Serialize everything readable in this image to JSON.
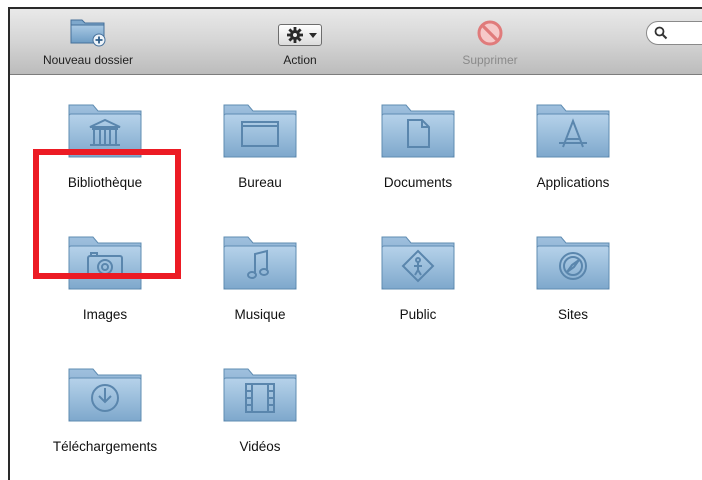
{
  "toolbar": {
    "new_folder_label": "Nouveau dossier",
    "action_label": "Action",
    "delete_label": "Supprimer"
  },
  "folders": [
    {
      "label": "Bibliothèque",
      "icon": "library-icon"
    },
    {
      "label": "Bureau",
      "icon": "desktop-icon"
    },
    {
      "label": "Documents",
      "icon": "document-icon"
    },
    {
      "label": "Applications",
      "icon": "applications-icon"
    },
    {
      "label": "Images",
      "icon": "camera-icon"
    },
    {
      "label": "Musique",
      "icon": "music-note-icon"
    },
    {
      "label": "Public",
      "icon": "public-sign-icon"
    },
    {
      "label": "Sites",
      "icon": "compass-icon"
    },
    {
      "label": "Téléchargements",
      "icon": "download-icon"
    },
    {
      "label": "Vidéos",
      "icon": "film-icon"
    }
  ],
  "colors": {
    "highlight": "#ec1b24",
    "folder": "#8fb6d6",
    "folder_dark": "#5f8cb2"
  }
}
